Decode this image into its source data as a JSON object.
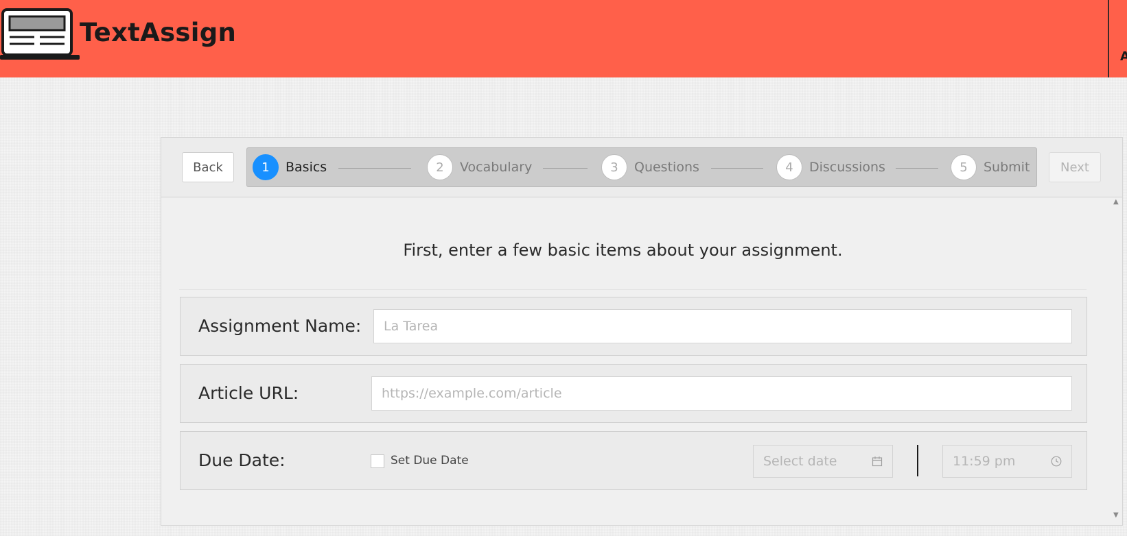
{
  "header": {
    "brand": "TextAssign",
    "right_text": "A",
    "background_color": "#ff604a",
    "logo_icon": "laptop-icon"
  },
  "toolbar": {
    "back_label": "Back",
    "next_label": "Next"
  },
  "steps": [
    {
      "number": "1",
      "label": "Basics",
      "active": true
    },
    {
      "number": "2",
      "label": "Vocabulary",
      "active": false
    },
    {
      "number": "3",
      "label": "Questions",
      "active": false
    },
    {
      "number": "4",
      "label": "Discussions",
      "active": false
    },
    {
      "number": "5",
      "label": "Submit",
      "active": false
    }
  ],
  "intro": "First, enter a few basic items about your assignment.",
  "form": {
    "assignment_name": {
      "label": "Assignment Name:",
      "placeholder": "La Tarea",
      "value": ""
    },
    "article_url": {
      "label": "Article URL:",
      "placeholder": "https://example.com/article",
      "value": ""
    },
    "due_date": {
      "label": "Due Date:",
      "checkbox_label": "Set Due Date",
      "checked": false,
      "date_placeholder": "Select date",
      "time_placeholder": "11:59 pm",
      "date_icon": "calendar-icon",
      "time_icon": "clock-icon"
    }
  },
  "colors": {
    "accent": "#1890ff"
  }
}
